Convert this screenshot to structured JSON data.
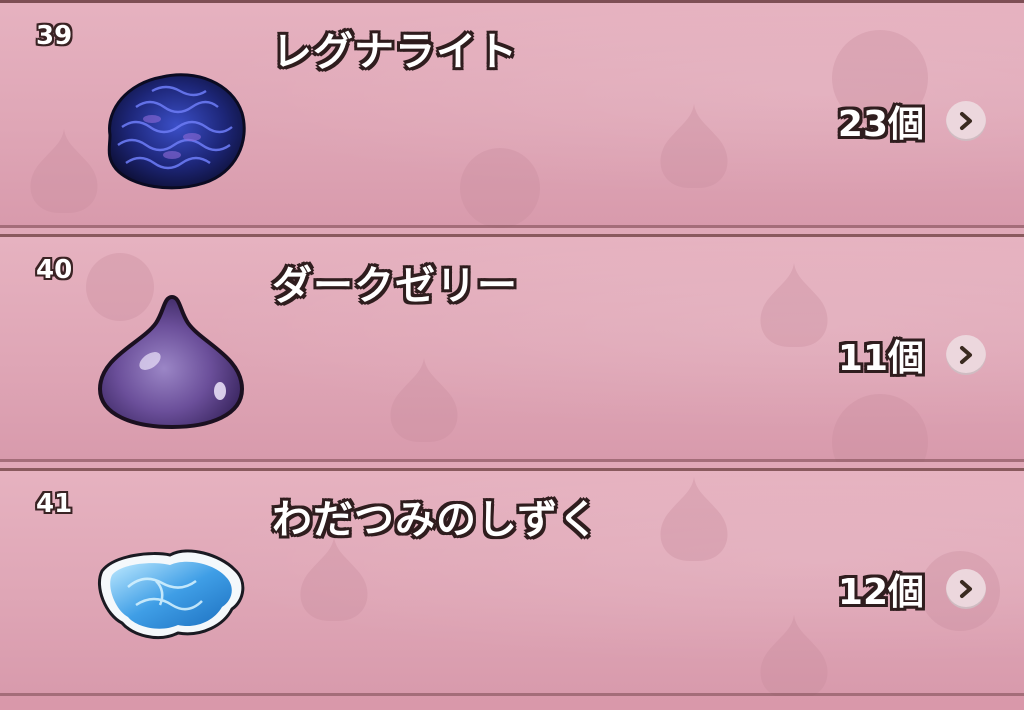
{
  "colors": {
    "row_bg": "#e3acbb",
    "divider": "#8a5a5e",
    "text": "#ffffff",
    "outline": "#2f1d1e",
    "chevron_bg": "#ecd7dd",
    "chevron": "#3a2a20"
  },
  "items": [
    {
      "number": "39",
      "name": "レグナライト",
      "quantity": "23個",
      "icon": "regnalite-ore-icon"
    },
    {
      "number": "40",
      "name": "ダークゼリー",
      "quantity": "11個",
      "icon": "dark-jelly-icon"
    },
    {
      "number": "41",
      "name": "わだつみのしずく",
      "quantity": "12個",
      "icon": "wadatsumi-drop-icon"
    }
  ]
}
